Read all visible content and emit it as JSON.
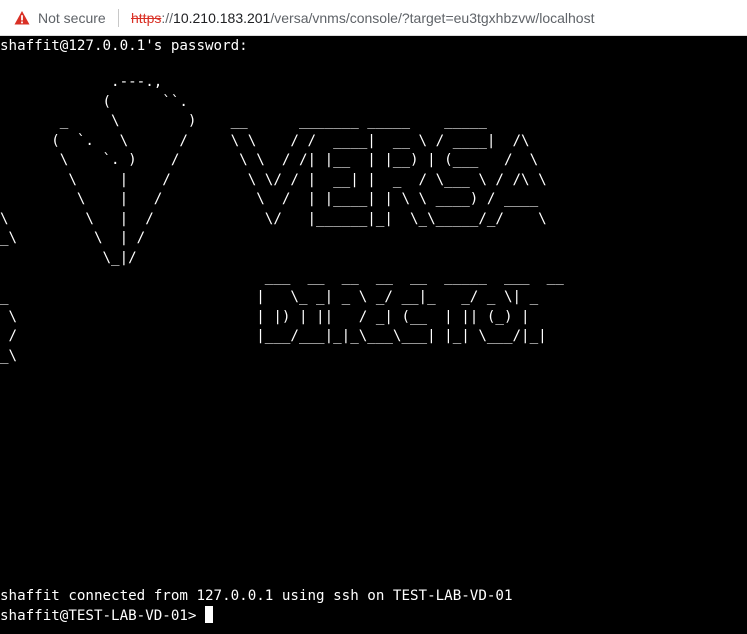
{
  "browser": {
    "security_label": "Not secure",
    "url_scheme": "https",
    "url_sep": "://",
    "url_host": "10.210.183.201",
    "url_path": "/versa/vnms/console/?target=eu3tgxhbzvw/localhost",
    "warning_color": "#d93025",
    "warning_icon": "warning-triangle-icon"
  },
  "terminal": {
    "password_prompt": "shaffit@127.0.0.1's password:",
    "banner_lines": [
      "             .---.,",
      "            (      ``.",
      "       _     \\        )    __      _______ _____    _____",
      "      (  `.   \\      /     \\ \\    / /  ____|  __ \\ / ____|  /\\",
      "       \\    `. )    /       \\ \\  / /| |__  | |__) | (___   /  \\",
      "        \\     |    /         \\ \\/ / |  __| |  _  / \\___ \\ / /\\ \\",
      "         \\    |   /           \\  /  | |____| | \\ \\ ____) / ____",
      "\\         \\   |  /             \\/   |______|_|  \\_\\_____/_/    \\",
      "_\\         \\  | /",
      "            \\_|/",
      "                               ___  __  __  __  __  _____  ___  __",
      "_                             |   \\_ _| _ \\ _/ __|_   _/ _ \\| _",
      " \\                            | |) | ||   / _| (__  | || (_) |",
      " /                            |___/___|_|_\\___\\___| |_| \\___/|_|",
      "_\\"
    ],
    "connected_line": "shaffit connected from 127.0.0.1 using ssh on TEST-LAB-VD-01",
    "shell_prompt": "shaffit@TEST-LAB-VD-01>"
  }
}
